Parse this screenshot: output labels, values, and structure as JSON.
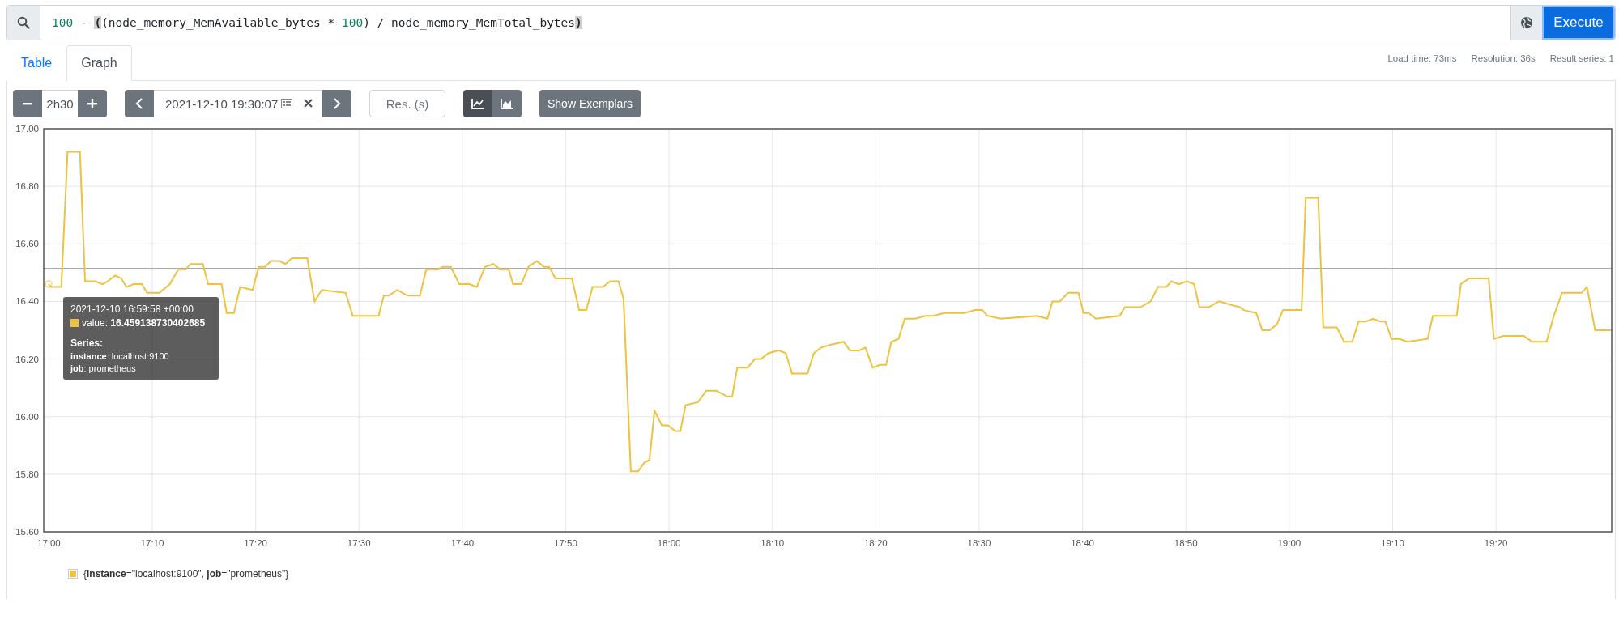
{
  "query_bar": {
    "tokens": [
      {
        "kind": "number",
        "text": "100"
      },
      {
        "kind": "plain",
        "text": " - "
      },
      {
        "kind": "paren-match",
        "text": "("
      },
      {
        "kind": "plain",
        "text": "(node_memory_MemAvailable_bytes * "
      },
      {
        "kind": "number",
        "text": "100"
      },
      {
        "kind": "plain",
        "text": ") / node_memory_MemTotal_bytes"
      },
      {
        "kind": "paren-match",
        "text": ")"
      }
    ],
    "execute_label": "Execute"
  },
  "tabs": [
    {
      "label": "Table",
      "selected": false
    },
    {
      "label": "Graph",
      "selected": true
    }
  ],
  "stats": [
    "Load time: 73ms",
    "Resolution: 36s",
    "Result series: 1"
  ],
  "controls": {
    "range": "2h30",
    "end_time": "2021-12-10 19:30:07",
    "resolution_placeholder": "Res. (s)",
    "chart_types": [
      {
        "kind": "line",
        "selected": true
      },
      {
        "kind": "stacked",
        "selected": false
      }
    ],
    "exemplars_button": "Show Exemplars"
  },
  "chart": {
    "chart_data": {
      "type": "line",
      "x": [
        1019.97,
        1020.2,
        1021.2,
        1021.8,
        1023,
        1023.5,
        1024.5,
        1025.2,
        1025.7,
        1026.4,
        1027,
        1027.5,
        1028.2,
        1029,
        1029.5,
        1030.7,
        1031.7,
        1032.5,
        1033.2,
        1033.7,
        1034.9,
        1035.4,
        1036.7,
        1037.2,
        1037.9,
        1038.5,
        1039.7,
        1040.3,
        1040.9,
        1041.5,
        1042.3,
        1042.9,
        1043.5,
        1044.2,
        1045,
        1045.7,
        1046.4,
        1048.7,
        1049.4,
        1050.4,
        1051.9,
        1052.4,
        1052.9,
        1053.7,
        1054.7,
        1055.9,
        1056.5,
        1057.5,
        1058.1,
        1058.9,
        1059.7,
        1060.7,
        1061.4,
        1062.2,
        1063,
        1063.7,
        1064.5,
        1064.9,
        1065.7,
        1066.4,
        1067.2,
        1067.9,
        1068.4,
        1069,
        1070.6,
        1071.3,
        1072,
        1072.6,
        1073.6,
        1074.3,
        1075.1,
        1075.6,
        1076.3,
        1077,
        1077.6,
        1078.1,
        1078.6,
        1079.3,
        1079.9,
        1080.6,
        1081.1,
        1081.6,
        1082.8,
        1083.6,
        1084.6,
        1085.6,
        1086.1,
        1086.6,
        1087.6,
        1088.3,
        1088.9,
        1089.6,
        1090.6,
        1091.3,
        1091.9,
        1093.4,
        1094,
        1094.7,
        1095.7,
        1096.9,
        1097.5,
        1098.4,
        1099,
        1099.7,
        1100.4,
        1101,
        1101.5,
        1102.2,
        1102.8,
        1103.8,
        1104.8,
        1105.6,
        1106.6,
        1108.6,
        1109.6,
        1110.3,
        1110.8,
        1112.1,
        1115.6,
        1116.6,
        1117.1,
        1117.8,
        1118.6,
        1119.6,
        1120.1,
        1120.6,
        1121.3,
        1123.6,
        1124.1,
        1125.6,
        1126.6,
        1127.3,
        1128.1,
        1128.6,
        1129.3,
        1130.1,
        1130.8,
        1131.3,
        1132.2,
        1133.2,
        1134.2,
        1135.2,
        1135.6,
        1136.8,
        1137.4,
        1138.1,
        1138.8,
        1139.4,
        1141.2,
        1141.6,
        1142.8,
        1143.3,
        1144.6,
        1145.3,
        1146.1,
        1146.7,
        1147.4,
        1148.1,
        1148.8,
        1149.3,
        1149.9,
        1150.7,
        1151.4,
        1153.4,
        1153.9,
        1156.2,
        1156.6,
        1157.4,
        1159.3,
        1159.8,
        1160.7,
        1162.7,
        1163.5,
        1164.9,
        1165.6,
        1166.4,
        1168.3,
        1168.8,
        1169.6,
        1171.2
      ],
      "series": [
        {
          "name": "{**instance**=\"localhost:9100\", **job**=\"prometheus\"}",
          "color": "#edc240",
          "values": [
            16.46,
            16.45,
            16.45,
            16.92,
            16.92,
            16.47,
            16.47,
            16.46,
            16.47,
            16.49,
            16.48,
            16.45,
            16.46,
            16.46,
            16.43,
            16.43,
            16.46,
            16.51,
            16.51,
            16.53,
            16.53,
            16.46,
            16.46,
            16.36,
            16.36,
            16.45,
            16.44,
            16.52,
            16.52,
            16.54,
            16.54,
            16.53,
            16.55,
            16.55,
            16.55,
            16.4,
            16.44,
            16.43,
            16.35,
            16.35,
            16.35,
            16.42,
            16.42,
            16.44,
            16.42,
            16.42,
            16.51,
            16.51,
            16.52,
            16.52,
            16.46,
            16.46,
            16.45,
            16.52,
            16.53,
            16.51,
            16.51,
            16.46,
            16.46,
            16.52,
            16.54,
            16.52,
            16.52,
            16.48,
            16.48,
            16.37,
            16.37,
            16.45,
            16.45,
            16.47,
            16.47,
            16.41,
            15.81,
            15.81,
            15.84,
            15.85,
            16.02,
            15.97,
            15.97,
            15.95,
            15.95,
            16.04,
            16.05,
            16.09,
            16.09,
            16.07,
            16.07,
            16.17,
            16.17,
            16.2,
            16.2,
            16.22,
            16.23,
            16.22,
            16.15,
            16.15,
            16.22,
            16.24,
            16.25,
            16.26,
            16.23,
            16.23,
            16.24,
            16.17,
            16.18,
            16.18,
            16.26,
            16.27,
            16.34,
            16.34,
            16.35,
            16.35,
            16.36,
            16.36,
            16.37,
            16.37,
            16.35,
            16.34,
            16.35,
            16.34,
            16.4,
            16.4,
            16.43,
            16.43,
            16.36,
            16.36,
            16.34,
            16.35,
            16.38,
            16.38,
            16.4,
            16.45,
            16.45,
            16.47,
            16.46,
            16.47,
            16.46,
            16.38,
            16.38,
            16.4,
            16.39,
            16.38,
            16.37,
            16.36,
            16.3,
            16.3,
            16.32,
            16.37,
            16.37,
            16.76,
            16.76,
            16.31,
            16.31,
            16.26,
            16.26,
            16.33,
            16.33,
            16.34,
            16.33,
            16.33,
            16.27,
            16.27,
            16.26,
            16.27,
            16.35,
            16.35,
            16.46,
            16.48,
            16.48,
            16.27,
            16.28,
            16.28,
            16.26,
            16.26,
            16.35,
            16.43,
            16.43,
            16.45,
            16.3,
            16.3
          ]
        }
      ],
      "xlim": [
        1019.5,
        1171.2
      ],
      "ylim": [
        15.6,
        17.0
      ],
      "xticks": [
        {
          "value": 1020,
          "label": "17:00"
        },
        {
          "value": 1030,
          "label": "17:10"
        },
        {
          "value": 1040,
          "label": "17:20"
        },
        {
          "value": 1050,
          "label": "17:30"
        },
        {
          "value": 1060,
          "label": "17:40"
        },
        {
          "value": 1070,
          "label": "17:50"
        },
        {
          "value": 1080,
          "label": "18:00"
        },
        {
          "value": 1090,
          "label": "18:10"
        },
        {
          "value": 1100,
          "label": "18:20"
        },
        {
          "value": 1110,
          "label": "18:30"
        },
        {
          "value": 1120,
          "label": "18:40"
        },
        {
          "value": 1130,
          "label": "18:50"
        },
        {
          "value": 1140,
          "label": "19:00"
        },
        {
          "value": 1150,
          "label": "19:10"
        },
        {
          "value": 1160,
          "label": "19:20"
        }
      ],
      "yticks": [
        {
          "value": 17.0,
          "label": "17.00"
        },
        {
          "value": 16.8,
          "label": "16.80"
        },
        {
          "value": 16.6,
          "label": "16.60"
        },
        {
          "value": 16.4,
          "label": "16.40"
        },
        {
          "value": 16.2,
          "label": "16.20"
        },
        {
          "value": 16.0,
          "label": "16.00"
        },
        {
          "value": 15.8,
          "label": "15.80"
        },
        {
          "value": 15.6,
          "label": "15.60"
        }
      ],
      "grid": true,
      "ref_lines": [
        {
          "axis": "y",
          "value": 16.515
        }
      ]
    }
  },
  "tooltip": {
    "time": "2021-12-10 16:59:58 +00:00",
    "value": "value: **16.459138730402685**",
    "series_title": "Series:",
    "labels": [
      "**instance**: localhost:9100",
      "**job**: prometheus"
    ]
  }
}
